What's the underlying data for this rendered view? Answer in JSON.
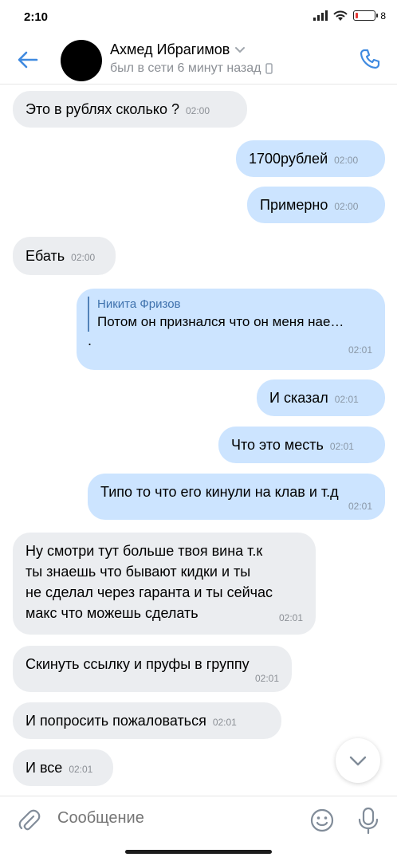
{
  "status_bar": {
    "time": "2:10",
    "battery_pct": "8",
    "battery_color": "#e53935"
  },
  "header": {
    "back_icon": "arrow-left-icon",
    "contact_name": "Ахмед Ибрагимов",
    "contact_status": "был в сети 6 минут назад",
    "call_icon": "phone-icon",
    "accent_color": "#3f8ae0"
  },
  "messages": [
    {
      "direction": "in",
      "text": "Это в рублях сколько ?",
      "time": "02:00"
    },
    {
      "direction": "out",
      "text": "1700рублей",
      "time": "02:00"
    },
    {
      "direction": "out",
      "text": "Примерно",
      "time": "02:00"
    },
    {
      "direction": "in",
      "text": "Ебать",
      "time": "02:00"
    },
    {
      "direction": "out",
      "reply_author": "Никита Фризов",
      "reply_text": "Потом он признался что он меня нае…",
      "text": ".",
      "time": "02:01"
    },
    {
      "direction": "out",
      "text": "И сказал",
      "time": "02:01"
    },
    {
      "direction": "out",
      "text": "Что это месть",
      "time": "02:01"
    },
    {
      "direction": "out",
      "text": "Типо то что его кинули на клав и т.д",
      "time": "02:01"
    },
    {
      "direction": "in",
      "lines": [
        "Ну смотри тут больше твоя вина т.к",
        "ты знаешь что бывают кидки и ты",
        "не сделал через гаранта и ты сейчас",
        "макс что можешь сделать"
      ],
      "time": "02:01"
    },
    {
      "direction": "in",
      "text": "Скинуть ссылку и пруфы в группу",
      "time": "02:01"
    },
    {
      "direction": "in",
      "text": "И попросить пожаловаться",
      "time": "02:01"
    },
    {
      "direction": "in",
      "text": "И все",
      "time": "02:01"
    }
  ],
  "composer": {
    "placeholder": "Сообщение",
    "attach_icon": "paperclip-icon",
    "emoji_icon": "smile-icon",
    "mic_icon": "microphone-icon"
  },
  "colors": {
    "incoming_bubble": "#ebedf0",
    "outgoing_bubble": "#cce4ff"
  }
}
